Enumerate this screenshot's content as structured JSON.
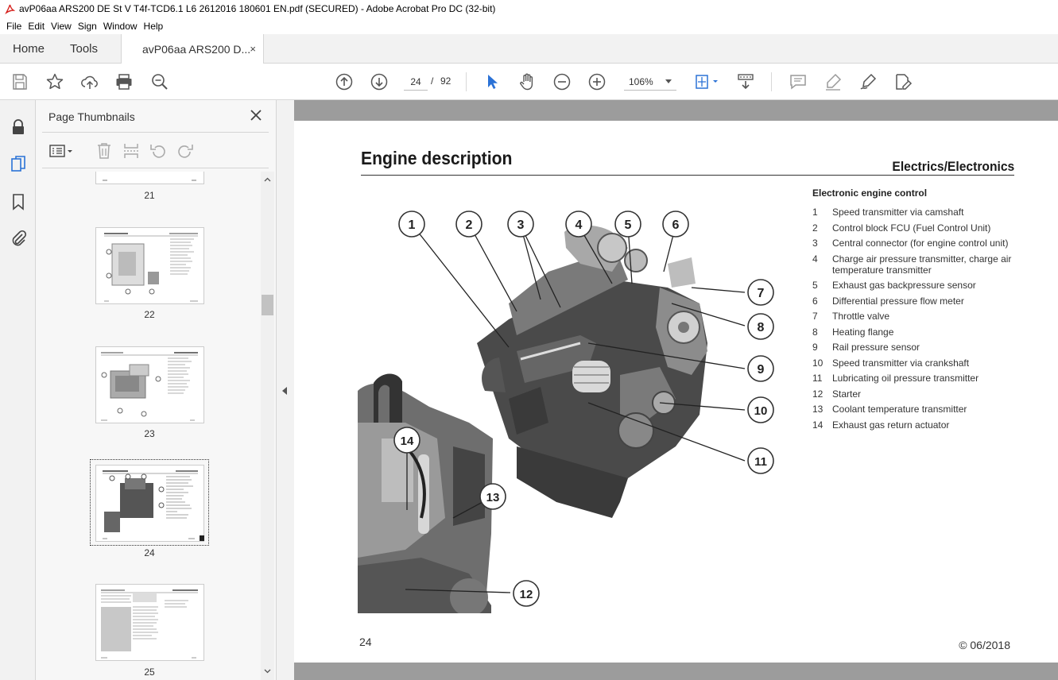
{
  "window": {
    "title": "avP06aa ARS200 DE St V T4f-TCD6.1 L6 2612016 180601 EN.pdf (SECURED) - Adobe Acrobat Pro DC (32-bit)"
  },
  "menu": [
    "File",
    "Edit",
    "View",
    "Sign",
    "Window",
    "Help"
  ],
  "tabs": {
    "home": "Home",
    "tools": "Tools",
    "document": "avP06aa ARS200 D...",
    "close": "×"
  },
  "toolbar": {
    "current_page": "24",
    "page_separator": "/",
    "total_pages": "92",
    "zoom": "106%"
  },
  "thumbnails": {
    "title": "Page Thumbnails",
    "pages": [
      "21",
      "22",
      "23",
      "24",
      "25"
    ],
    "selected": "24"
  },
  "document": {
    "title": "Engine description",
    "subtitle": "Electrics/Electronics",
    "legend_heading": "Electronic engine control",
    "legend": [
      {
        "num": "1",
        "text": "Speed transmitter via camshaft"
      },
      {
        "num": "2",
        "text": "Control block FCU (Fuel Control Unit)"
      },
      {
        "num": "3",
        "text": "Central connector (for engine control unit)"
      },
      {
        "num": "4",
        "text": "Charge air pressure transmitter, charge air temperature transmitter"
      },
      {
        "num": "5",
        "text": "Exhaust gas backpressure sensor"
      },
      {
        "num": "6",
        "text": "Differential pressure flow meter"
      },
      {
        "num": "7",
        "text": "Throttle valve"
      },
      {
        "num": "8",
        "text": "Heating flange"
      },
      {
        "num": "9",
        "text": "Rail pressure sensor"
      },
      {
        "num": "10",
        "text": "Speed transmitter via crankshaft"
      },
      {
        "num": "11",
        "text": "Lubricating oil pressure transmitter"
      },
      {
        "num": "12",
        "text": "Starter"
      },
      {
        "num": "13",
        "text": "Coolant temperature transmitter"
      },
      {
        "num": "14",
        "text": "Exhaust gas return actuator"
      }
    ],
    "callouts": [
      "1",
      "2",
      "3",
      "4",
      "5",
      "6",
      "7",
      "8",
      "9",
      "10",
      "11",
      "12",
      "13",
      "14"
    ],
    "page_number": "24",
    "copyright": "© 06/2018"
  }
}
